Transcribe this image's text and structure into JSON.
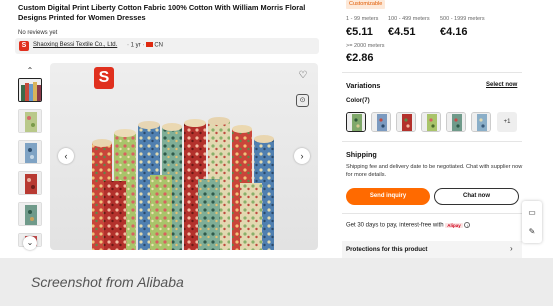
{
  "product": {
    "title": "Custom Digital Print Liberty Cotton Fabric 100% Cotton With William Morris Floral Designs Printed for Women Dresses",
    "reviews": "No reviews yet"
  },
  "supplier": {
    "logo_letter": "S",
    "name": "Shaoxing Bessi Textile Co., Ltd.",
    "meta": "· 1 yr ·",
    "country": "CN"
  },
  "gallery": {
    "badge_letter": "S",
    "prev_icon": "chevron-left-icon",
    "next_icon": "chevron-right-icon"
  },
  "pricing": {
    "badge": "Customizable",
    "tiers": [
      {
        "range": "1 - 99 meters",
        "price": "€5.11"
      },
      {
        "range": "100 - 499 meters",
        "price": "€4.51"
      },
      {
        "range": "500 - 1999 meters",
        "price": "€4.16"
      },
      {
        "range": ">= 2000 meters",
        "price": "€2.86"
      }
    ]
  },
  "variations": {
    "title": "Variations",
    "select_link": "Select now",
    "color_label": "Color(7)",
    "more": "+1"
  },
  "shipping": {
    "title": "Shipping",
    "text": "Shipping fee and delivery date to be negotiated. Chat with supplier now for more details."
  },
  "actions": {
    "inquiry": "Send inquiry",
    "chat": "Chat now"
  },
  "payment": {
    "text": "Get 30 days to pay, interest-free with",
    "logo": "Alipay",
    "info": "i"
  },
  "protection": {
    "title": "Protections for this product"
  },
  "caption": "Screenshot from Alibaba",
  "colors": {
    "accent": "#ff6a00",
    "brand_red": "#e0301e"
  }
}
